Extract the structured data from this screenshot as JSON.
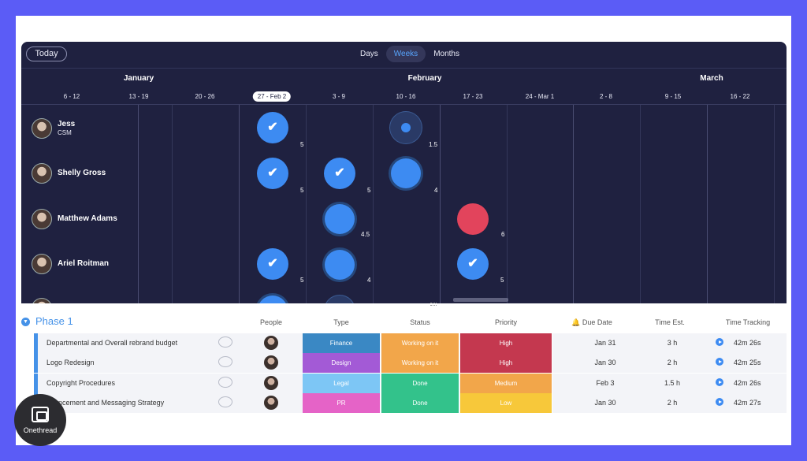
{
  "toolbar": {
    "today_label": "Today",
    "views": [
      "Days",
      "Weeks",
      "Months"
    ],
    "active_view": "Weeks"
  },
  "months": [
    "January",
    "February",
    "March"
  ],
  "weeks": [
    "6 - 12",
    "13 - 19",
    "20 - 26",
    "27 - Feb 2",
    "3 - 9",
    "10 - 16",
    "17 - 23",
    "24 - Mar 1",
    "2 - 8",
    "9 - 15",
    "16 - 22"
  ],
  "people": [
    {
      "name": "Jess",
      "role": "CSM"
    },
    {
      "name": "Shelly Gross",
      "role": ""
    },
    {
      "name": "Matthew Adams",
      "role": ""
    },
    {
      "name": "Ariel Roitman",
      "role": ""
    }
  ],
  "workload": [
    {
      "hours": "5"
    },
    {
      "hours": "1.5"
    },
    {
      "hours": "5"
    },
    {
      "hours": "5"
    },
    {
      "hours": "4"
    },
    {
      "hours": "4.5"
    },
    {
      "hours": "6"
    },
    {
      "hours": "5"
    },
    {
      "hours": "4"
    },
    {
      "hours": "5"
    }
  ],
  "table": {
    "group_title": "Phase 1",
    "columns": {
      "people": "People",
      "type": "Type",
      "status": "Status",
      "priority": "Priority",
      "due": "Due Date",
      "est": "Time Est.",
      "tracking": "Time Tracking"
    },
    "rows": [
      {
        "name": "Departmental and Overall rebrand budget",
        "type": "Finance",
        "status": "Working on it",
        "priority": "High",
        "due": "Jan 31",
        "est": "3 h",
        "tracking": "42m 26s"
      },
      {
        "name": "Logo Redesign",
        "type": "Design",
        "status": "Working on it",
        "priority": "High",
        "due": "Jan 30",
        "est": "2 h",
        "tracking": "42m 25s"
      },
      {
        "name": "Copyright Procedures",
        "type": "Legal",
        "status": "Done",
        "priority": "Medium",
        "due": "Feb 3",
        "est": "1.5 h",
        "tracking": "42m 26s"
      },
      {
        "name": "nouncement and Messaging Strategy",
        "type": "PR",
        "status": "Done",
        "priority": "Low",
        "due": "Jan 30",
        "est": "2 h",
        "tracking": "42m 27s"
      }
    ]
  },
  "brand": {
    "name": "Onethread"
  },
  "colors": {
    "accent": "#4592e8",
    "timeline_bg": "#1f2140",
    "frame_bg": "#5b5cf6",
    "finance": "#3a88c4",
    "design": "#a35ad6",
    "legal": "#7dc6f5",
    "pr": "#e563c7",
    "working": "#f2a64a",
    "done": "#33c28b",
    "high": "#c4384f",
    "medium": "#f2a64a",
    "low": "#f7c83a"
  }
}
